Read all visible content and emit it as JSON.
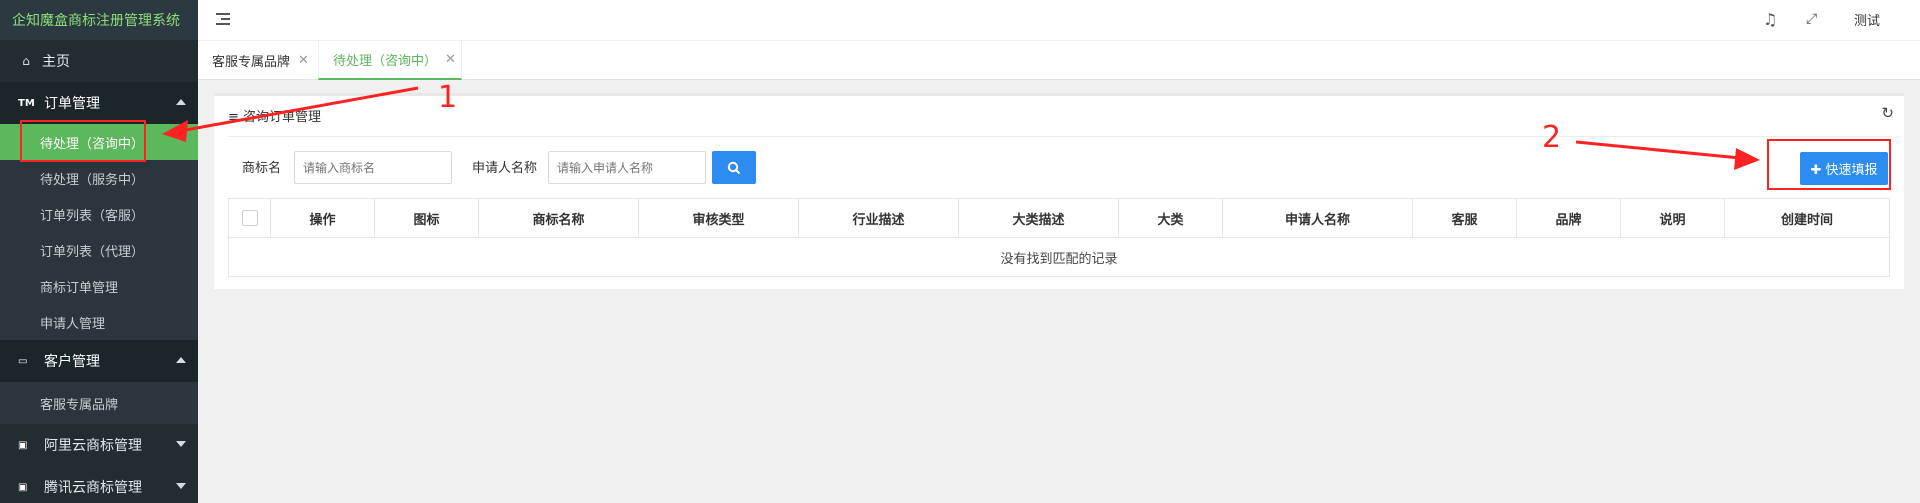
{
  "app": {
    "title": "企知魔盒商标注册管理系统"
  },
  "sidebar": {
    "home": {
      "label": "主页",
      "icon": "home-icon"
    },
    "groups": [
      {
        "label": "订单管理",
        "icon_text": "TM",
        "expanded": true,
        "items": [
          "待处理（咨询中）",
          "待处理（服务中）",
          "订单列表（客服）",
          "订单列表（代理）",
          "商标订单管理",
          "申请人管理"
        ]
      },
      {
        "label": "客户管理",
        "icon": "monitor-icon",
        "expanded": true,
        "items": [
          "客服专属品牌"
        ]
      },
      {
        "label": "阿里云商标管理",
        "icon": "cloud-icon",
        "expanded": false,
        "items": []
      },
      {
        "label": "腾讯云商标管理",
        "icon": "cloud-icon",
        "expanded": false,
        "items": []
      }
    ],
    "active_item": "待处理（咨询中）"
  },
  "header": {
    "icons": [
      "menu-toggle-icon",
      "bell-icon",
      "fullscreen-icon"
    ],
    "user": "测试"
  },
  "tabs": [
    {
      "label": "客服专属品牌",
      "active": false
    },
    {
      "label": "待处理（咨询中）",
      "active": true
    }
  ],
  "panel": {
    "title": "≡ 咨询订单管理",
    "search": {
      "trademark_label": "商标名",
      "trademark_placeholder": "请输入商标名",
      "applicant_label": "申请人名称",
      "applicant_placeholder": "请输入申请人名称"
    },
    "quick_button": "✚ 快速填报",
    "table": {
      "columns": [
        "操作",
        "图标",
        "商标名称",
        "审核类型",
        "行业描述",
        "大类描述",
        "大类",
        "申请人名称",
        "客服",
        "品牌",
        "说明",
        "创建时间"
      ],
      "empty_text": "没有找到匹配的记录"
    }
  },
  "annotations": {
    "marker1": "1",
    "marker2": "2",
    "color": "#ff2222"
  },
  "colors": {
    "accent_green": "#5cb85c",
    "primary_blue": "#2d8cf0",
    "sidebar_bg": "#222d32"
  }
}
